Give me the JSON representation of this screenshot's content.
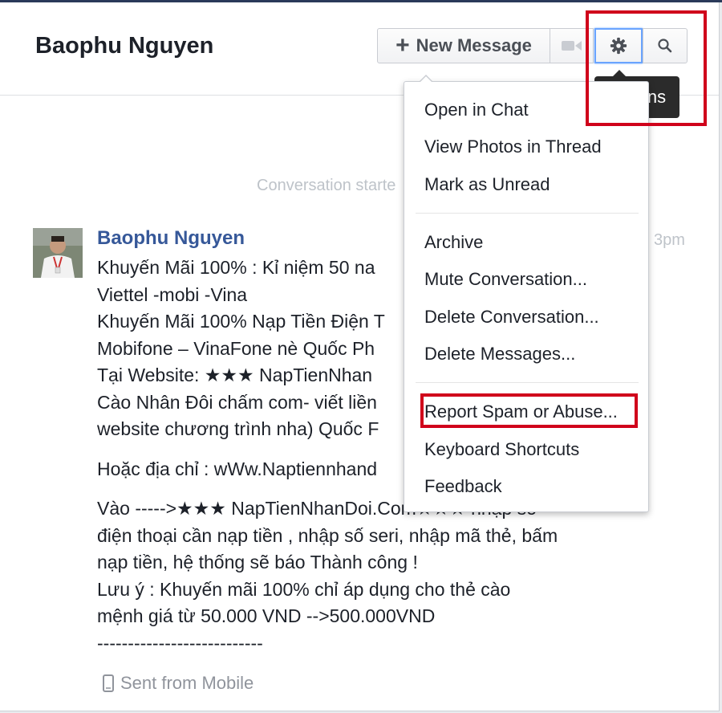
{
  "header": {
    "title": "Baophu Nguyen",
    "new_message_label": "New Message",
    "actions_tooltip": "Actions"
  },
  "icons": {
    "plus": "plus-icon",
    "video": "video-camera-icon",
    "gear": "gear-icon",
    "search": "search-icon",
    "mobile": "mobile-phone-icon"
  },
  "conversation": {
    "started_text": "Conversation starte",
    "time_partial": "3pm",
    "sender_name": "Baophu Nguyen",
    "message_lines_1": [
      "Khuyến Mãi 100%  :  Kỉ niệm 50 na",
      "Viettel -mobi -Vina",
      "Khuyến Mãi 100% Nạp Tiền Điện T",
      "Mobifone – VinaFone  nè Quốc Ph",
      "Tại Website: ★★★ NapTienNhan",
      "Cào Nhân Đôi chấm com- viết liền",
      "website chương trình nha) Quốc F"
    ],
    "message_line_2": "Hoặc địa chỉ : wWw.Naptiennhand",
    "message_lines_3": [
      "Vào ----->★★★ NapTienNhanDoi.Com★★★ nhập số",
      "điện thoại cần nạp tiền , nhập số seri, nhập mã thẻ, bấm",
      "nạp tiền, hệ thống sẽ báo Thành công !",
      "Lưu ý : Khuyến mãi 100%  chỉ áp dụng cho thẻ cào",
      "mệnh giá từ 50.000 VND -->500.000VND",
      "---------------------------"
    ],
    "sent_from": "Sent from Mobile"
  },
  "actions_menu": {
    "group1": [
      "Open in Chat",
      "View Photos in Thread",
      "Mark as Unread"
    ],
    "group2": [
      "Archive",
      "Mute Conversation...",
      "Delete Conversation...",
      "Delete Messages..."
    ],
    "group3": [
      "Report Spam or Abuse...",
      "Keyboard Shortcuts",
      "Feedback"
    ]
  },
  "colors": {
    "highlight": "#d0021b",
    "link": "#365899",
    "focus": "#6aa4ff"
  }
}
